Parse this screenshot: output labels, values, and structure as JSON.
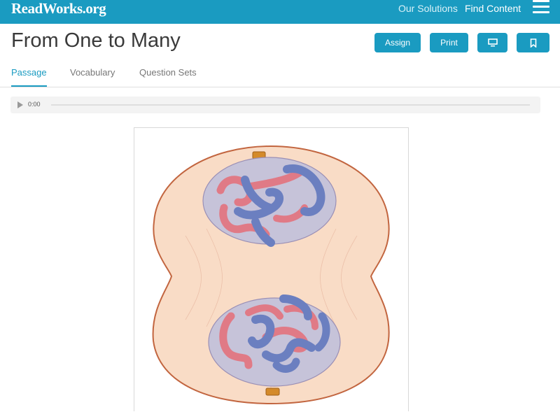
{
  "header": {
    "logo": "ReadWorks.org",
    "nav": [
      "Our Solutions",
      "Find Content"
    ],
    "menu_icon": "hamburger-menu-icon",
    "background_color": "#1a9bc1"
  },
  "page": {
    "title": "From One to Many",
    "actions": {
      "assign_label": "Assign",
      "print_label": "Print",
      "present_icon": "monitor-icon",
      "bookmark_icon": "bookmark-icon"
    }
  },
  "tabs": [
    {
      "label": "Passage",
      "active": true
    },
    {
      "label": "Vocabulary",
      "active": false
    },
    {
      "label": "Question Sets",
      "active": false
    }
  ],
  "audio": {
    "time": "0:00",
    "play_icon": "play-icon"
  },
  "figure": {
    "subject": "cell division illustration"
  }
}
